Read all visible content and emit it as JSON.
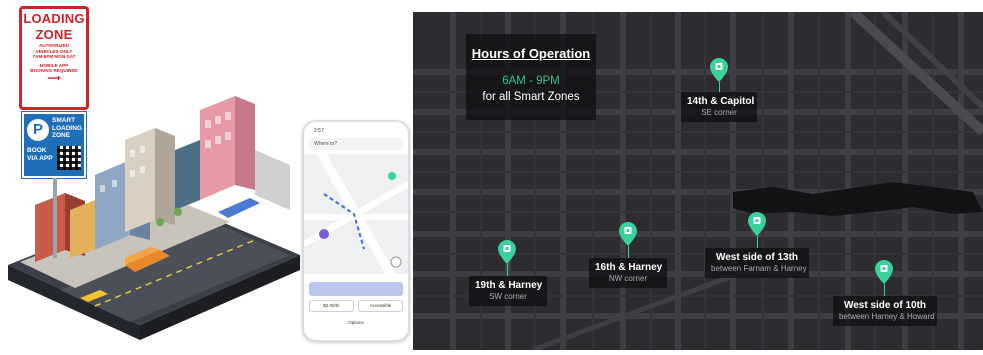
{
  "illustration": {
    "loading_sign": {
      "title_line1": "LOADING",
      "title_line2": "ZONE",
      "line_authorized": "AUTHORIZED",
      "line_vehicles": "VEHICLES ONLY",
      "line_hours": "7AM-6PM MON-SAT",
      "line_mobile": "MOBILE APP",
      "line_booking": "BOOKING REQUIRED",
      "arrow": "⟶"
    },
    "smart_sign": {
      "p_letter": "P",
      "line1": "SMART",
      "line2": "LOADING",
      "line3": "ZONE",
      "line4": "BOOK",
      "line5": "VIA APP"
    }
  },
  "phone": {
    "status_time": "2:57",
    "search_placeholder": "Where to?",
    "option_1": "$2.00/hr",
    "option_2": "Accessible",
    "button": "Options"
  },
  "map": {
    "hours": {
      "title": "Hours of Operation",
      "time": "6AM - 9PM",
      "subtitle": "for all Smart Zones"
    },
    "zones": [
      {
        "name": "14th & Capitol",
        "desc": "SE corner"
      },
      {
        "name": "16th & Harney",
        "desc": "NW corner"
      },
      {
        "name": "19th & Harney",
        "desc": "SW corner"
      },
      {
        "name": "West side of 13th",
        "desc": "between Farnam & Harney"
      },
      {
        "name": "West side of 10th",
        "desc": "between Harney & Howard"
      }
    ],
    "colors": {
      "pin": "#3ad19a",
      "map_bg": "#2c2c31",
      "road": "#3d3d43",
      "accent_text": "#35c58e"
    }
  }
}
